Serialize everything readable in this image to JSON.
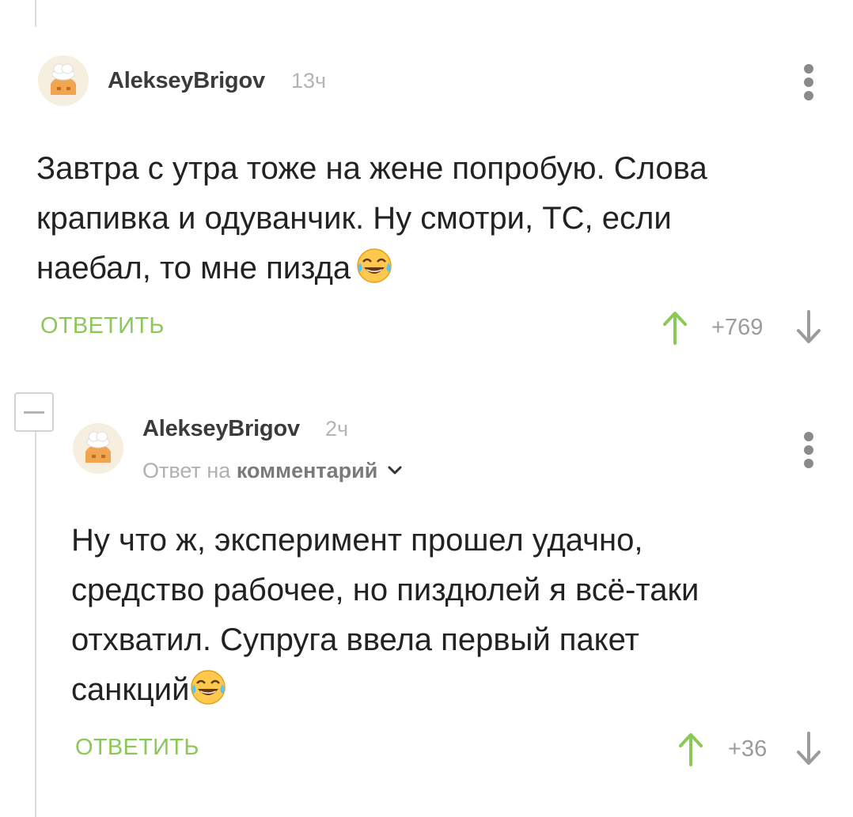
{
  "comments": [
    {
      "author": "AlekseyBrigov",
      "time": "13ч",
      "text_lines": [
        "Завтра с утра тоже на жене попробую. Слова",
        "крапивка и одуванчик. Ну смотри, ТС, если",
        "наебал, то мне пизда"
      ],
      "emoji": "face-with-tears-of-joy",
      "reply_label": "ОТВЕТИТЬ",
      "rating": "+769"
    },
    {
      "author": "AlekseyBrigov",
      "time": "2ч",
      "reply_to_prefix": "Ответ на",
      "reply_to_link": "комментарий",
      "text_lines": [
        "Ну что ж, эксперимент прошел удачно,",
        "средство рабочее, но пиздюлей я всё-таки",
        "отхватил. Супруга ввела первый пакет",
        "санкций"
      ],
      "emoji": "face-with-tears-of-joy",
      "reply_label": "ОТВЕТИТЬ",
      "rating": "+36"
    }
  ],
  "colors": {
    "reply_button": "#8ac858",
    "vote_up": "#8ac858",
    "vote_down": "#9b9b9b",
    "thread_line": "#dcdcdc"
  },
  "icons": [
    "kebab-menu-icon",
    "arrow-up-icon",
    "arrow-down-icon",
    "chevron-down-icon",
    "collapse-minus-icon",
    "face-with-tears-of-joy"
  ]
}
